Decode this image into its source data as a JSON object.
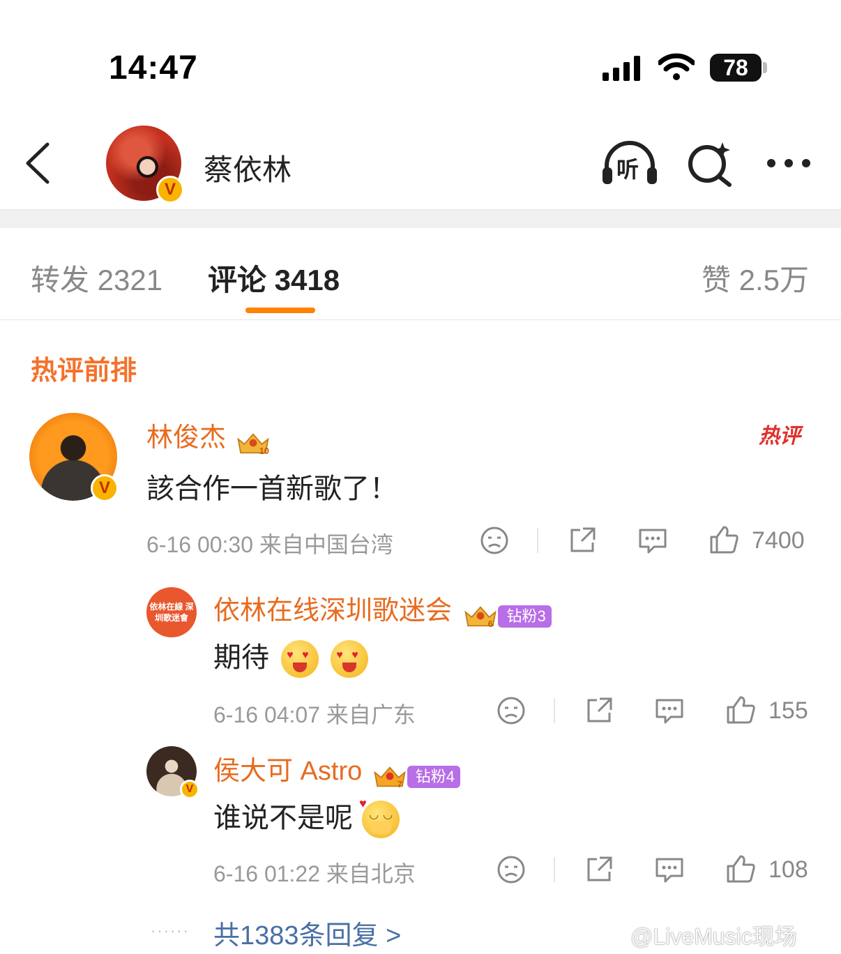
{
  "status_bar": {
    "time": "14:47",
    "battery": "78"
  },
  "header": {
    "back_icon": "chevron-left-icon",
    "title": "蔡依林",
    "verified": "V",
    "listen_label": "听"
  },
  "tabs": [
    {
      "label": "转发 2321"
    },
    {
      "label": "评论 3418",
      "active": true
    },
    {
      "label": "赞 2.5万"
    }
  ],
  "section_title": "热评前排",
  "comment": {
    "username": "林俊杰",
    "crown_level": "10",
    "hot_tag": "热评",
    "text": "該合作一首新歌了！",
    "meta": "6-16 00:30  来自中国台湾",
    "likes": "7400",
    "verified": "V",
    "replies": [
      {
        "username": "依林在线深圳歌迷会",
        "avatar_text": "依林在線 深圳歌迷會",
        "crown_level": "6",
        "fan_badge": "钻粉3",
        "text": "期待",
        "meta": "6-16 04:07  来自广东",
        "likes": "155"
      },
      {
        "username": "侯大可 Astro",
        "crown_level": "7",
        "fan_badge": "钻粉4",
        "verified": "V",
        "text": "谁说不是呢",
        "meta": "6-16 01:22  来自北京",
        "likes": "108"
      }
    ],
    "more_replies": "共1383条回复 >"
  },
  "watermark": "@LiveMusic现场",
  "colors": {
    "accent": "#ff8200",
    "username": "#e86b1f",
    "fan_badge": "#b86ee6",
    "hot": "#e0302a"
  }
}
